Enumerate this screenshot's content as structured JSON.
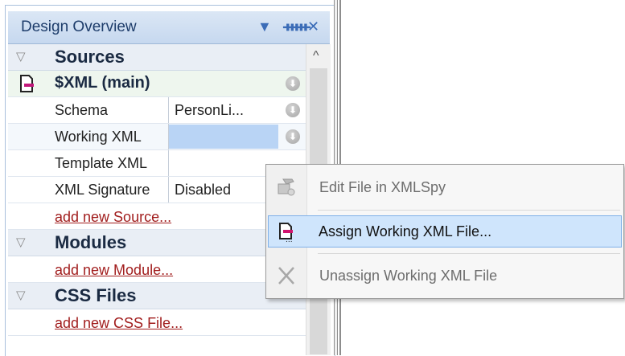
{
  "panel": {
    "title": "Design Overview",
    "controls": {
      "menu_glyph": "▼",
      "pin_glyph": "ᚔ",
      "close_glyph": "✕"
    }
  },
  "sources_section": {
    "label": "Sources",
    "main_source": {
      "label": "$XML (main)",
      "icon": "xml-document-icon"
    },
    "properties": [
      {
        "name": "Schema",
        "value": "PersonLi..."
      },
      {
        "name": "Working XML",
        "value": ""
      },
      {
        "name": "Template XML",
        "value": ""
      },
      {
        "name": "XML Signature",
        "value": "Disabled"
      }
    ],
    "add_link": "add new Source..."
  },
  "modules_section": {
    "label": "Modules",
    "add_link": "add new Module..."
  },
  "css_section": {
    "label": "CSS Files",
    "add_link": "add new CSS File..."
  },
  "scrollbar": {
    "up_glyph": "^"
  },
  "context_menu": {
    "items": [
      {
        "label": "Edit File in XMLSpy",
        "icon": "edit-file-icon",
        "enabled": false
      },
      {
        "label": "Assign Working XML File...",
        "icon": "assign-file-icon",
        "enabled": true,
        "highlighted": true
      },
      {
        "label": "Unassign Working XML File",
        "icon": "unassign-x-icon",
        "enabled": false
      }
    ]
  },
  "colors": {
    "title_bar": "#c6d8ef",
    "section_header": "#e9eef5",
    "selected_value": "#b9d4f5",
    "menu_highlight": "#cfe5fc",
    "link": "#a11d1d"
  }
}
